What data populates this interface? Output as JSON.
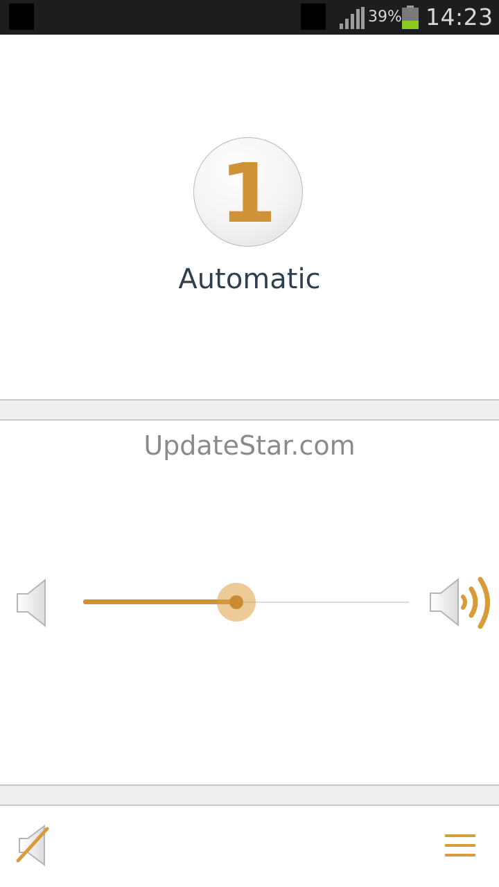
{
  "status_bar": {
    "battery_percent": "39%",
    "battery_level": 0.39,
    "time": "14:23"
  },
  "program": {
    "number": "1",
    "name": "Automatic"
  },
  "site_label": "UpdateStar.com",
  "volume": {
    "level": 0.47
  },
  "icons": {
    "volume_low": "speaker-low-icon",
    "volume_high": "speaker-high-icon",
    "mute": "speaker-muted-icon",
    "menu": "hamburger-menu-icon"
  },
  "colors": {
    "accent": "#cf9236",
    "program_text": "#2f3f4e",
    "status_bar": "#1d1d1d",
    "battery_fill": "#8ccc1e"
  }
}
